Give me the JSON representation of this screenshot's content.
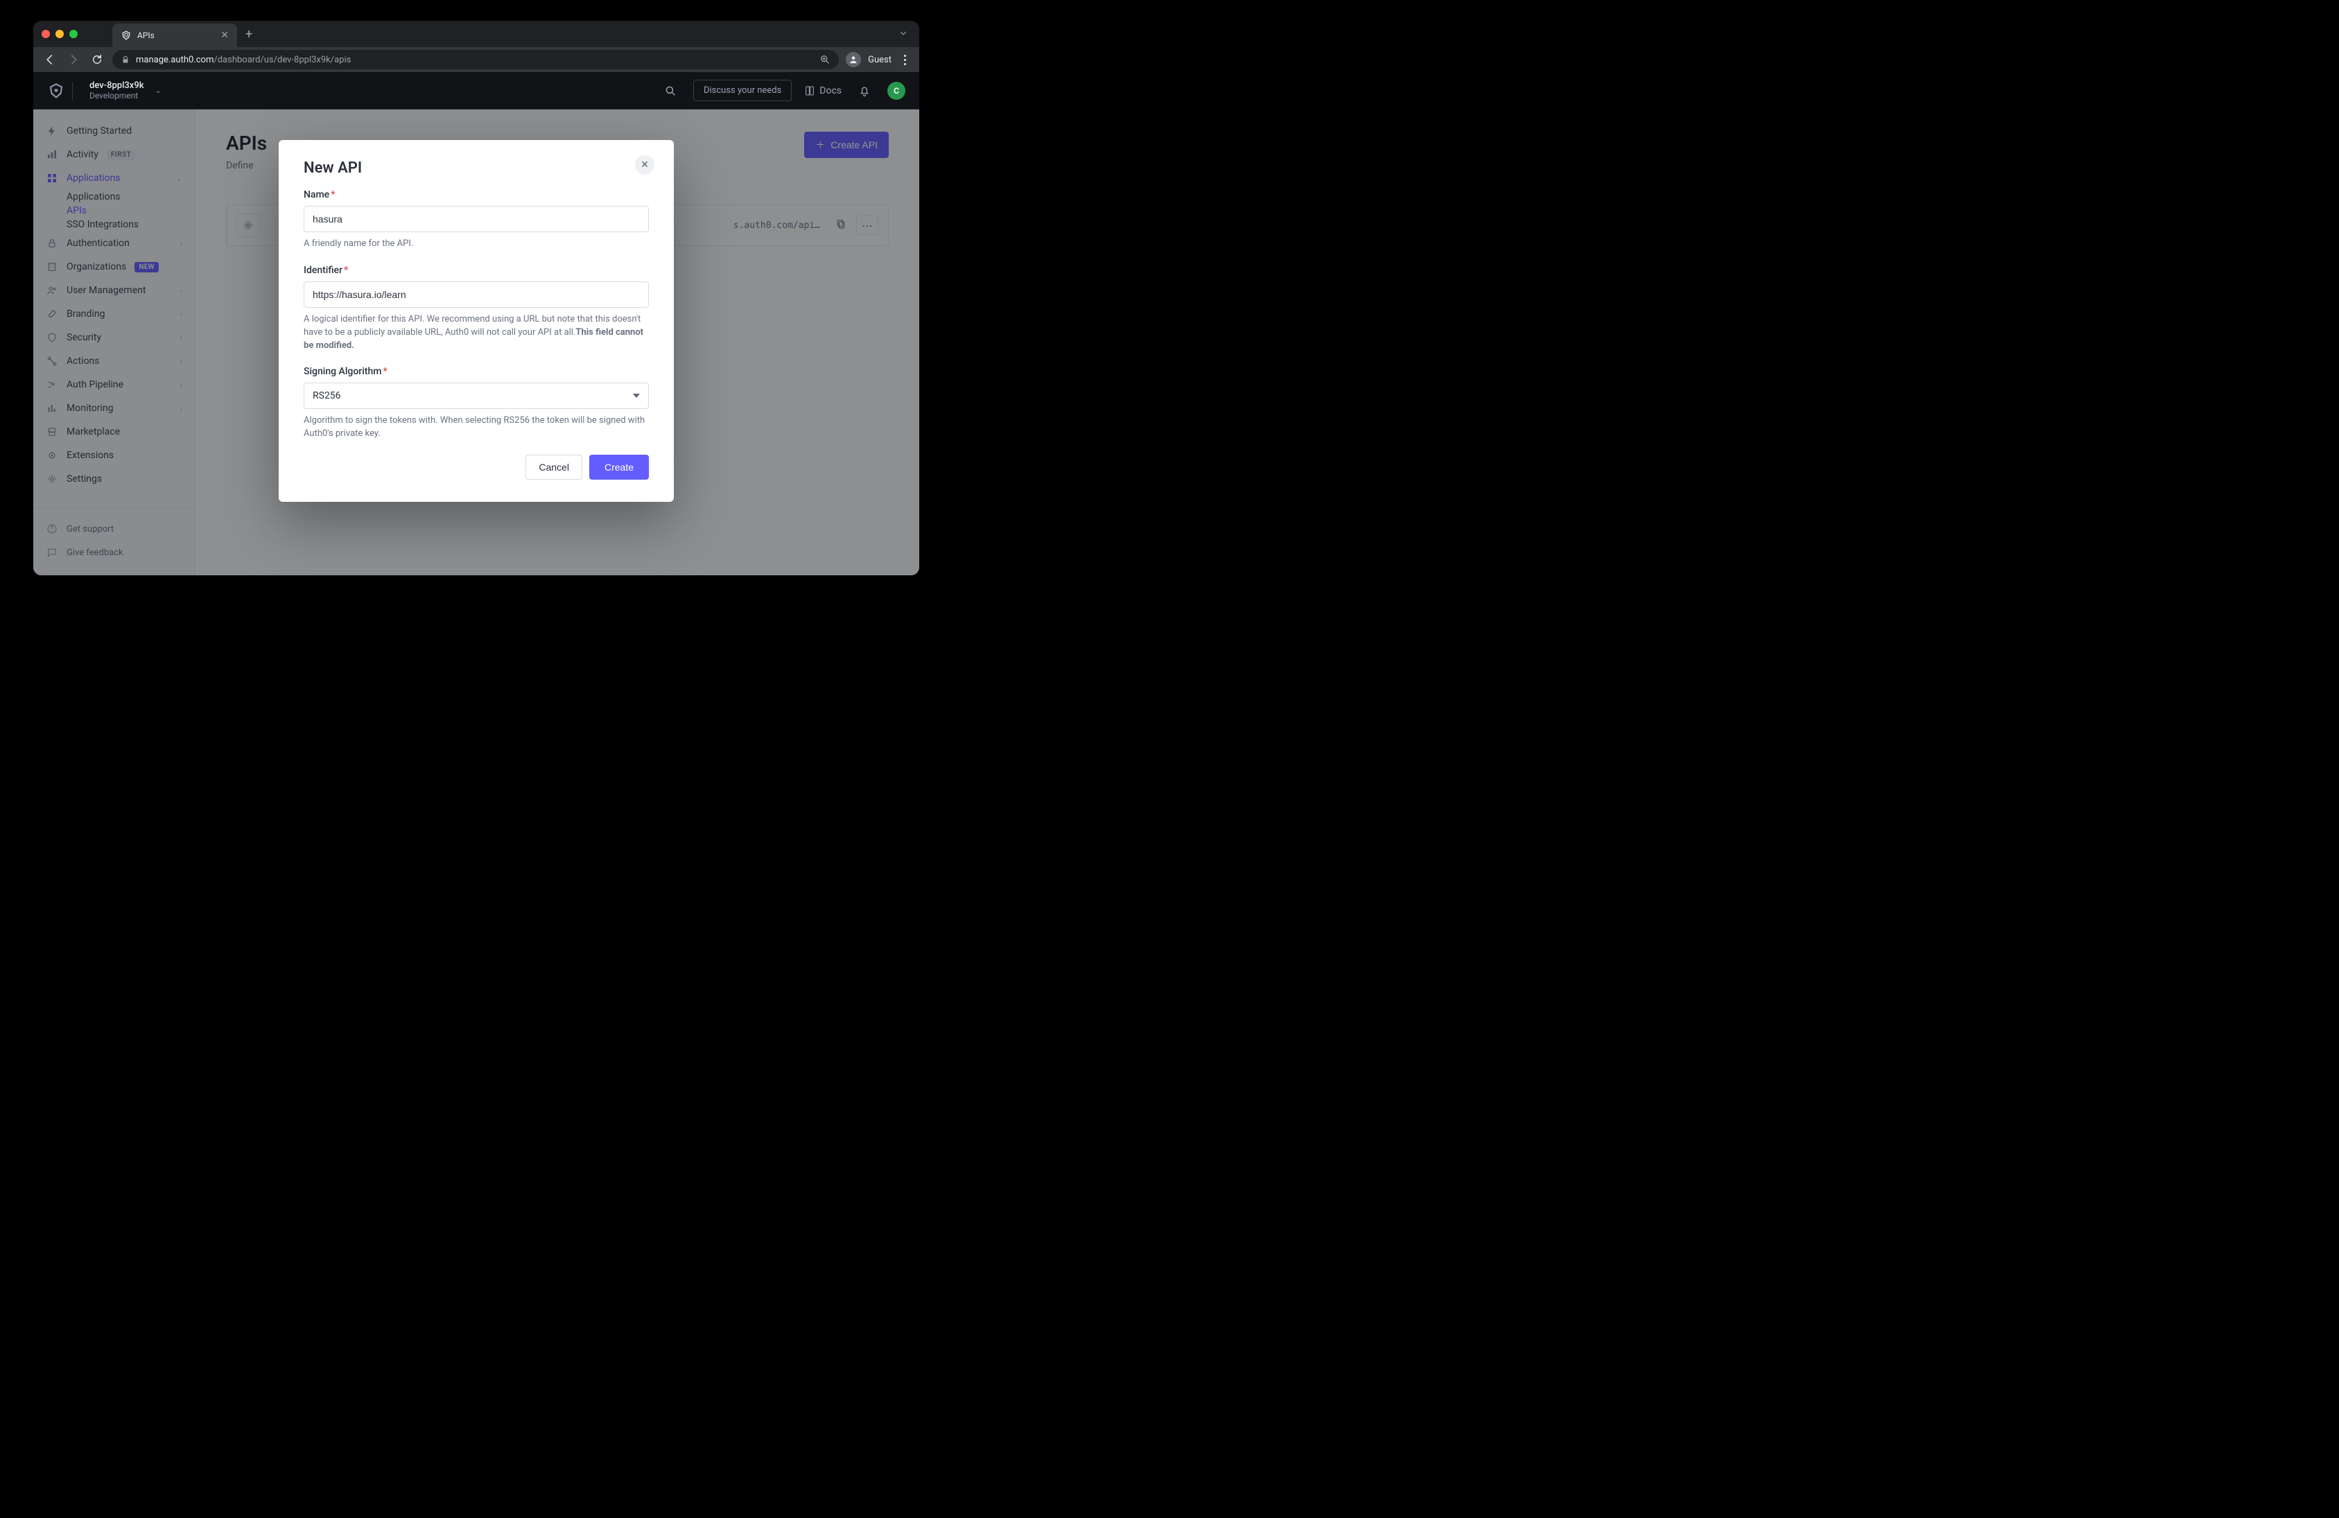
{
  "browser": {
    "tab_title": "APIs",
    "url_host": "manage.auth0.com",
    "url_path": "/dashboard/us/dev-8ppl3x9k/apis",
    "profile_label": "Guest"
  },
  "topbar": {
    "tenant_name": "dev-8ppl3x9k",
    "tenant_env": "Development",
    "discuss_label": "Discuss your needs",
    "docs_label": "Docs",
    "avatar_initial": "C"
  },
  "sidebar": {
    "getting_started": "Getting Started",
    "activity": "Activity",
    "activity_badge": "FIRST",
    "applications": "Applications",
    "applications_sub": "Applications",
    "apis_sub": "APIs",
    "sso_sub": "SSO Integrations",
    "authentication": "Authentication",
    "organizations": "Organizations",
    "org_badge": "NEW",
    "user_mgmt": "User Management",
    "branding": "Branding",
    "security": "Security",
    "actions": "Actions",
    "auth_pipeline": "Auth Pipeline",
    "monitoring": "Monitoring",
    "marketplace": "Marketplace",
    "extensions": "Extensions",
    "settings": "Settings",
    "get_support": "Get support",
    "give_feedback": "Give feedback"
  },
  "page": {
    "title": "APIs",
    "subtitle": "Define ",
    "create_btn": "Create API",
    "api_row_identifier_trunc": "s.auth0.com/api…"
  },
  "modal": {
    "title": "New API",
    "name_label": "Name",
    "name_value": "hasura",
    "name_help": "A friendly name for the API.",
    "identifier_label": "Identifier",
    "identifier_value": "https://hasura.io/learn",
    "identifier_help_a": "A logical identifier for this API. We recommend using a URL but note that this doesn't have to be a publicly available URL, Auth0 will not call your API at all.",
    "identifier_help_b": "This field cannot be modified.",
    "algo_label": "Signing Algorithm",
    "algo_value": "RS256",
    "algo_help": "Algorithm to sign the tokens with. When selecting RS256 the token will be signed with Auth0's private key.",
    "cancel_label": "Cancel",
    "create_label": "Create"
  }
}
